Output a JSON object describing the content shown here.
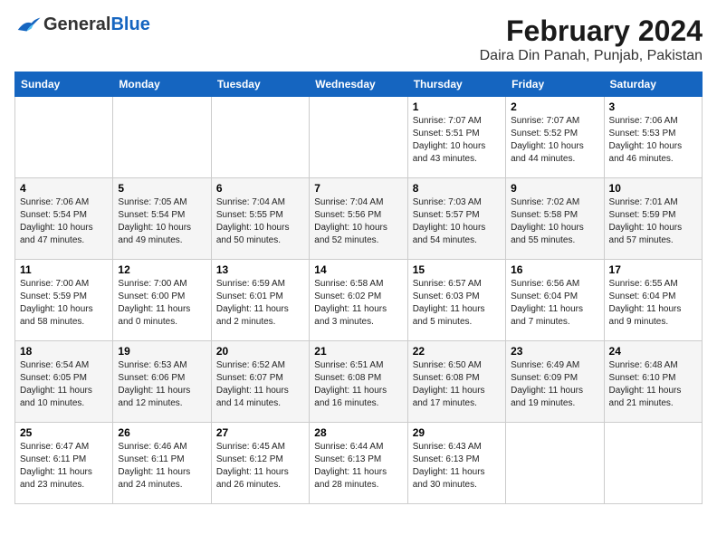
{
  "header": {
    "logo_general": "General",
    "logo_blue": "Blue",
    "title": "February 2024",
    "subtitle": "Daira Din Panah, Punjab, Pakistan"
  },
  "calendar": {
    "columns": [
      "Sunday",
      "Monday",
      "Tuesday",
      "Wednesday",
      "Thursday",
      "Friday",
      "Saturday"
    ],
    "weeks": [
      [
        {
          "day": "",
          "info": ""
        },
        {
          "day": "",
          "info": ""
        },
        {
          "day": "",
          "info": ""
        },
        {
          "day": "",
          "info": ""
        },
        {
          "day": "1",
          "info": "Sunrise: 7:07 AM\nSunset: 5:51 PM\nDaylight: 10 hours\nand 43 minutes."
        },
        {
          "day": "2",
          "info": "Sunrise: 7:07 AM\nSunset: 5:52 PM\nDaylight: 10 hours\nand 44 minutes."
        },
        {
          "day": "3",
          "info": "Sunrise: 7:06 AM\nSunset: 5:53 PM\nDaylight: 10 hours\nand 46 minutes."
        }
      ],
      [
        {
          "day": "4",
          "info": "Sunrise: 7:06 AM\nSunset: 5:54 PM\nDaylight: 10 hours\nand 47 minutes."
        },
        {
          "day": "5",
          "info": "Sunrise: 7:05 AM\nSunset: 5:54 PM\nDaylight: 10 hours\nand 49 minutes."
        },
        {
          "day": "6",
          "info": "Sunrise: 7:04 AM\nSunset: 5:55 PM\nDaylight: 10 hours\nand 50 minutes."
        },
        {
          "day": "7",
          "info": "Sunrise: 7:04 AM\nSunset: 5:56 PM\nDaylight: 10 hours\nand 52 minutes."
        },
        {
          "day": "8",
          "info": "Sunrise: 7:03 AM\nSunset: 5:57 PM\nDaylight: 10 hours\nand 54 minutes."
        },
        {
          "day": "9",
          "info": "Sunrise: 7:02 AM\nSunset: 5:58 PM\nDaylight: 10 hours\nand 55 minutes."
        },
        {
          "day": "10",
          "info": "Sunrise: 7:01 AM\nSunset: 5:59 PM\nDaylight: 10 hours\nand 57 minutes."
        }
      ],
      [
        {
          "day": "11",
          "info": "Sunrise: 7:00 AM\nSunset: 5:59 PM\nDaylight: 10 hours\nand 58 minutes."
        },
        {
          "day": "12",
          "info": "Sunrise: 7:00 AM\nSunset: 6:00 PM\nDaylight: 11 hours\nand 0 minutes."
        },
        {
          "day": "13",
          "info": "Sunrise: 6:59 AM\nSunset: 6:01 PM\nDaylight: 11 hours\nand 2 minutes."
        },
        {
          "day": "14",
          "info": "Sunrise: 6:58 AM\nSunset: 6:02 PM\nDaylight: 11 hours\nand 3 minutes."
        },
        {
          "day": "15",
          "info": "Sunrise: 6:57 AM\nSunset: 6:03 PM\nDaylight: 11 hours\nand 5 minutes."
        },
        {
          "day": "16",
          "info": "Sunrise: 6:56 AM\nSunset: 6:04 PM\nDaylight: 11 hours\nand 7 minutes."
        },
        {
          "day": "17",
          "info": "Sunrise: 6:55 AM\nSunset: 6:04 PM\nDaylight: 11 hours\nand 9 minutes."
        }
      ],
      [
        {
          "day": "18",
          "info": "Sunrise: 6:54 AM\nSunset: 6:05 PM\nDaylight: 11 hours\nand 10 minutes."
        },
        {
          "day": "19",
          "info": "Sunrise: 6:53 AM\nSunset: 6:06 PM\nDaylight: 11 hours\nand 12 minutes."
        },
        {
          "day": "20",
          "info": "Sunrise: 6:52 AM\nSunset: 6:07 PM\nDaylight: 11 hours\nand 14 minutes."
        },
        {
          "day": "21",
          "info": "Sunrise: 6:51 AM\nSunset: 6:08 PM\nDaylight: 11 hours\nand 16 minutes."
        },
        {
          "day": "22",
          "info": "Sunrise: 6:50 AM\nSunset: 6:08 PM\nDaylight: 11 hours\nand 17 minutes."
        },
        {
          "day": "23",
          "info": "Sunrise: 6:49 AM\nSunset: 6:09 PM\nDaylight: 11 hours\nand 19 minutes."
        },
        {
          "day": "24",
          "info": "Sunrise: 6:48 AM\nSunset: 6:10 PM\nDaylight: 11 hours\nand 21 minutes."
        }
      ],
      [
        {
          "day": "25",
          "info": "Sunrise: 6:47 AM\nSunset: 6:11 PM\nDaylight: 11 hours\nand 23 minutes."
        },
        {
          "day": "26",
          "info": "Sunrise: 6:46 AM\nSunset: 6:11 PM\nDaylight: 11 hours\nand 24 minutes."
        },
        {
          "day": "27",
          "info": "Sunrise: 6:45 AM\nSunset: 6:12 PM\nDaylight: 11 hours\nand 26 minutes."
        },
        {
          "day": "28",
          "info": "Sunrise: 6:44 AM\nSunset: 6:13 PM\nDaylight: 11 hours\nand 28 minutes."
        },
        {
          "day": "29",
          "info": "Sunrise: 6:43 AM\nSunset: 6:13 PM\nDaylight: 11 hours\nand 30 minutes."
        },
        {
          "day": "",
          "info": ""
        },
        {
          "day": "",
          "info": ""
        }
      ]
    ]
  }
}
